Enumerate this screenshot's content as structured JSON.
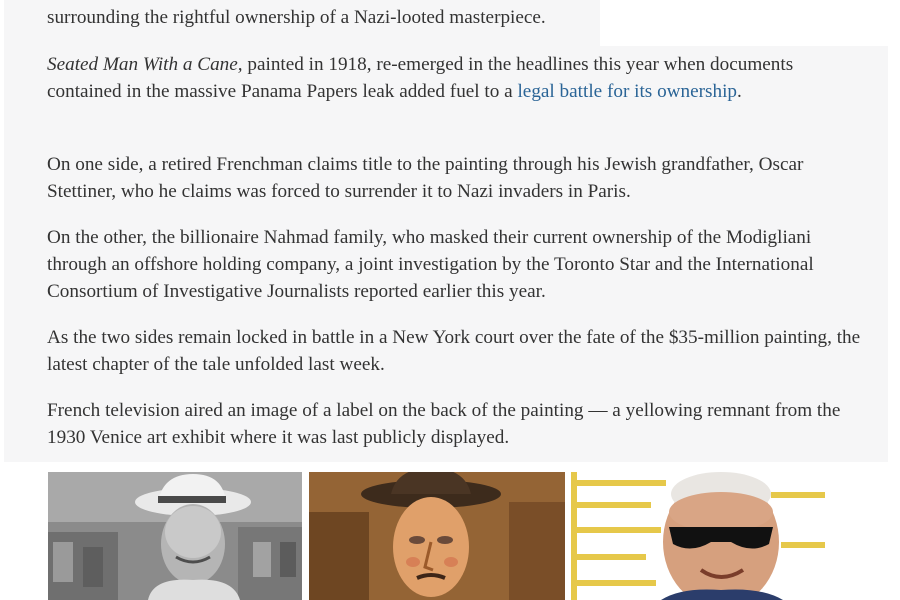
{
  "article": {
    "p0": "surrounding the rightful ownership of a Nazi-looted masterpiece.",
    "p1_title": "Seated Man With a Cane,",
    "p1_text": " painted in 1918, re-emerged in the headlines this year when documents contained in the massive Panama Papers leak added fuel to a ",
    "p1_link": "legal battle for its ownership",
    "p1_end": ".",
    "p2": "On one side, a retired Frenchman claims title to the painting through his Jewish grandfather, Oscar Stettiner, who he claims was forced to surrender it to Nazi invaders in Paris.",
    "p3": "On the other, the billionaire Nahmad family, who masked their current ownership of the Modigliani through an offshore holding company, a joint investigation by the Toronto Star and the International Consortium of Investigative Journalists reported earlier this year.",
    "p4": "As the two sides remain locked in battle in a New York court over the fate of the $35-million painting, the latest chapter of the tale unfolded last week.",
    "p5": "French television aired an image of a label on the back of the painting — a yellowing remnant from the 1930 Venice art exhibit where it was last publicly displayed."
  },
  "colors": {
    "text": "#333333",
    "link": "#2a6496",
    "panel_background": "#f6f6f7"
  }
}
